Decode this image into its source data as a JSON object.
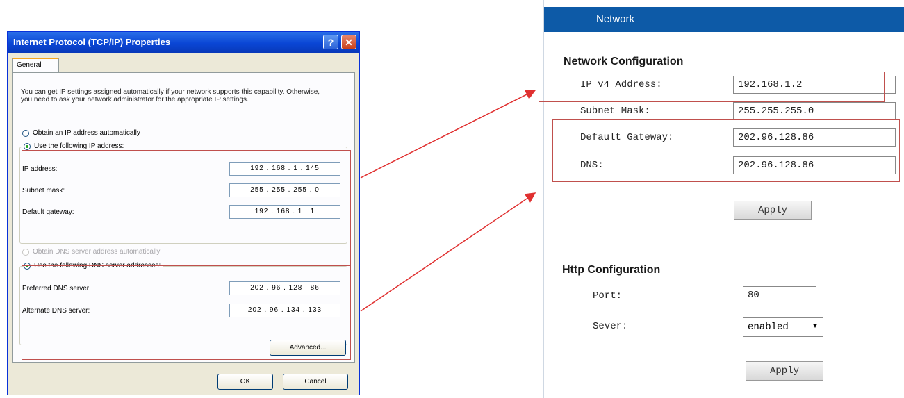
{
  "dialog": {
    "title": "Internet Protocol (TCP/IP) Properties",
    "help_label": "?",
    "close_label": "✕",
    "tab_general": "General",
    "description": "You can get IP settings assigned automatically if your network supports this capability. Otherwise, you need to ask your network administrator for the appropriate IP settings.",
    "radio_obtain_ip": "Obtain an IP address automatically",
    "radio_use_ip": "Use the following IP address:",
    "ip_address_label": "IP address:",
    "ip_address_value": "192 . 168 . 1 . 145",
    "subnet_mask_label": "Subnet mask:",
    "subnet_mask_value": "255 . 255 . 255 . 0",
    "default_gateway_label": "Default gateway:",
    "default_gateway_value": "192 . 168 . 1 . 1",
    "radio_obtain_dns": "Obtain DNS server address automatically",
    "radio_use_dns": "Use the following DNS server addresses:",
    "preferred_dns_label": "Preferred DNS server:",
    "preferred_dns_value": "202 . 96 . 128 . 86",
    "alternate_dns_label": "Alternate DNS server:",
    "alternate_dns_value": "202 . 96 . 134 . 133",
    "advanced_label": "Advanced...",
    "ok_label": "OK",
    "cancel_label": "Cancel"
  },
  "web": {
    "header": "Network",
    "network_section": "Network Configuration",
    "ipv4_label": "IP v4 Address:",
    "ipv4_value": "192.168.1.2",
    "subnet_label": "Subnet Mask:",
    "subnet_value": "255.255.255.0",
    "gateway_label": "Default Gateway:",
    "gateway_value": "202.96.128.86",
    "dns_label": "DNS:",
    "dns_value": "202.96.128.86",
    "apply_label": "Apply",
    "http_section": "Http Configuration",
    "port_label": "Port:",
    "port_value": "80",
    "server_label": "Sever:",
    "server_value": "enabled",
    "apply2_label": "Apply"
  },
  "colors": {
    "xp_title": "#0a46d5",
    "web_header": "#0d5aa7",
    "highlight": "#e03030"
  }
}
